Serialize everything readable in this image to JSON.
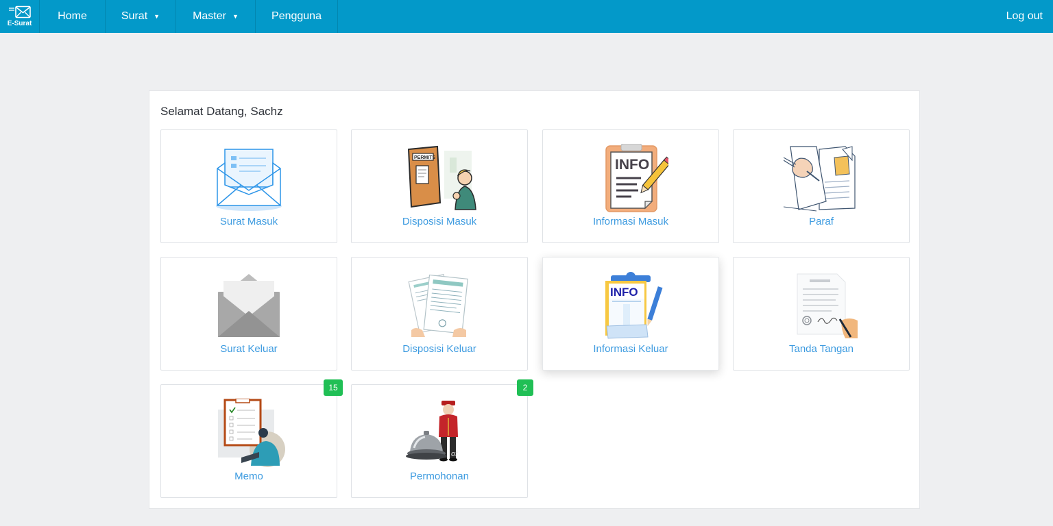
{
  "nav": {
    "brand": "E-Surat",
    "items": [
      {
        "label": "Home"
      },
      {
        "label": "Surat"
      },
      {
        "label": "Master"
      },
      {
        "label": "Pengguna"
      }
    ],
    "logout": "Log out"
  },
  "welcome": "Selamat Datang, Sachz",
  "cards": [
    {
      "label": "Surat Masuk",
      "icon": "inbox-envelope-icon"
    },
    {
      "label": "Disposisi Masuk",
      "icon": "permit-board-icon"
    },
    {
      "label": "Informasi Masuk",
      "icon": "info-clipboard-icon",
      "icon_text": "INFO"
    },
    {
      "label": "Paraf",
      "icon": "paraf-documents-icon"
    },
    {
      "label": "Surat Keluar",
      "icon": "outbox-envelope-icon"
    },
    {
      "label": "Disposisi Keluar",
      "icon": "documents-stack-icon"
    },
    {
      "label": "Informasi Keluar",
      "icon": "info-board-icon",
      "icon_text": "INFO"
    },
    {
      "label": "Tanda Tangan",
      "icon": "signature-document-icon"
    },
    {
      "label": "Memo",
      "icon": "memo-checklist-icon",
      "badge": "15"
    },
    {
      "label": "Permohonan",
      "icon": "service-bell-icon",
      "badge": "2"
    }
  ],
  "colors": {
    "navbar": "#0399c9",
    "link": "#3d9be0",
    "badge": "#20bf55",
    "background": "#eeeff1"
  }
}
